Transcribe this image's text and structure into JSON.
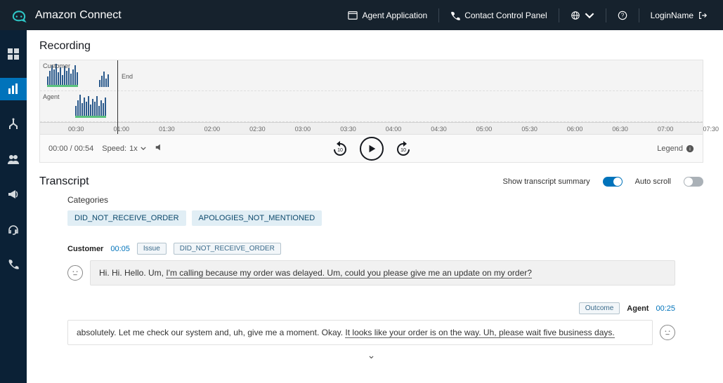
{
  "header": {
    "brand": "Amazon Connect",
    "agent_app": "Agent Application",
    "ccp": "Contact Control Panel",
    "login_name": "LoginName"
  },
  "recording": {
    "title": "Recording",
    "row_labels": {
      "customer": "Customer",
      "agent": "Agent"
    },
    "end_label": "End",
    "time_ticks": [
      "00:30",
      "01:00",
      "01:30",
      "02:00",
      "02:30",
      "03:00",
      "03:30",
      "04:00",
      "04:30",
      "05:00",
      "05:30",
      "06:00",
      "06:30",
      "07:00",
      "07:30"
    ],
    "time_readout": "00:00 / 00:54",
    "speed_label": "Speed:",
    "speed_value": "1x",
    "legend_label": "Legend"
  },
  "transcript": {
    "title": "Transcript",
    "summary_label": "Show transcript summary",
    "autoscroll_label": "Auto scroll",
    "categories_label": "Categories",
    "categories": [
      "DID_NOT_RECEIVE_ORDER",
      "APOLOGIES_NOT_MENTIONED"
    ],
    "turns": [
      {
        "speaker": "Customer",
        "time": "00:05",
        "tags": [
          "Issue",
          "DID_NOT_RECEIVE_ORDER"
        ],
        "text_plain": "Hi. Hi. Hello. Um, ",
        "text_ul": "I'm calling because my order was delayed. Um, could you please give me an update on my order?"
      },
      {
        "speaker": "Agent",
        "time": "00:25",
        "tags": [
          "Outcome"
        ],
        "text_plain": "absolutely. Let me check our system and, uh, give me a moment. Okay. ",
        "text_ul": "It looks like your order is on the way. Uh, please wait five business days."
      }
    ]
  }
}
